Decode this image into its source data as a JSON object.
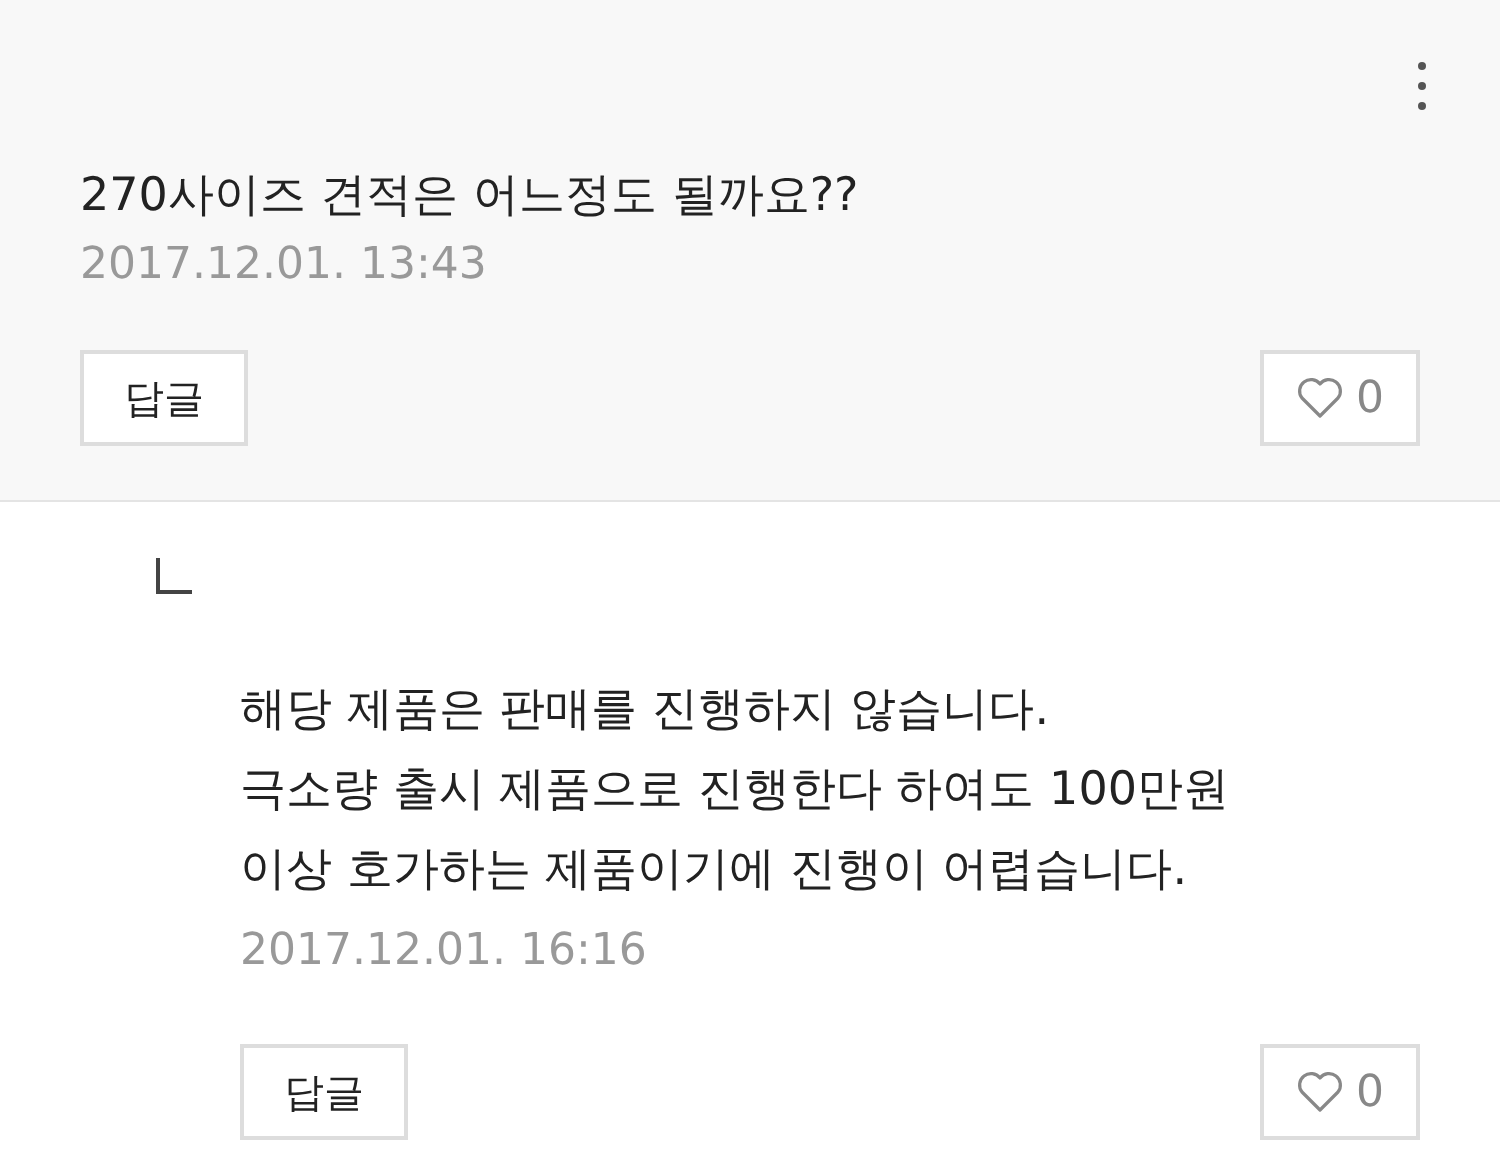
{
  "comments": [
    {
      "kind": "comment",
      "body": [
        "270사이즈 견적은 어느정도 될까요??"
      ],
      "date": "2017.12.01. 13:43",
      "reply_button": "답글",
      "likes": "0"
    },
    {
      "kind": "reply",
      "body": [
        "해당 제품은 판매를 진행하지 않습니다.",
        "극소량 출시 제품으로 진행한다 하여도 100만원",
        "이상 호가하는 제품이기에 진행이 어렵습니다."
      ],
      "date": "2017.12.01. 16:16",
      "reply_button": "답글",
      "likes": "0"
    }
  ]
}
